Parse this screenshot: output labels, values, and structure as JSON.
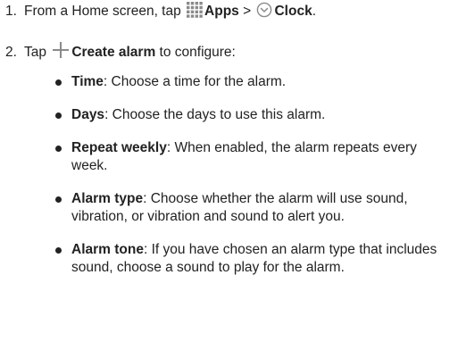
{
  "steps": [
    {
      "number": "1.",
      "text_before": "From a Home screen, tap",
      "apps_label": "Apps",
      "separator": ">",
      "clock_label": "Clock",
      "end": ".",
      "icons": [
        "apps-grid-icon",
        "clock-icon"
      ]
    },
    {
      "number": "2.",
      "text_before": "Tap",
      "create_label": "Create alarm",
      "text_after": "to configure:",
      "icons": [
        "plus-icon"
      ]
    }
  ],
  "bullets": [
    {
      "term": "Time",
      "desc": ": Choose a time for the alarm."
    },
    {
      "term": "Days",
      "desc": ": Choose the days to use this alarm."
    },
    {
      "term": "Repeat weekly",
      "desc": ": When enabled, the alarm repeats every week."
    },
    {
      "term": "Alarm type",
      "desc": ": Choose whether the alarm will use sound, vibration, or vibration and sound to alert you."
    },
    {
      "term": "Alarm tone",
      "desc": ": If you have chosen an alarm type that includes sound, choose a sound to play for the alarm."
    }
  ],
  "colors": {
    "text": "#222222",
    "icon_gray": "#8a8a8a"
  }
}
